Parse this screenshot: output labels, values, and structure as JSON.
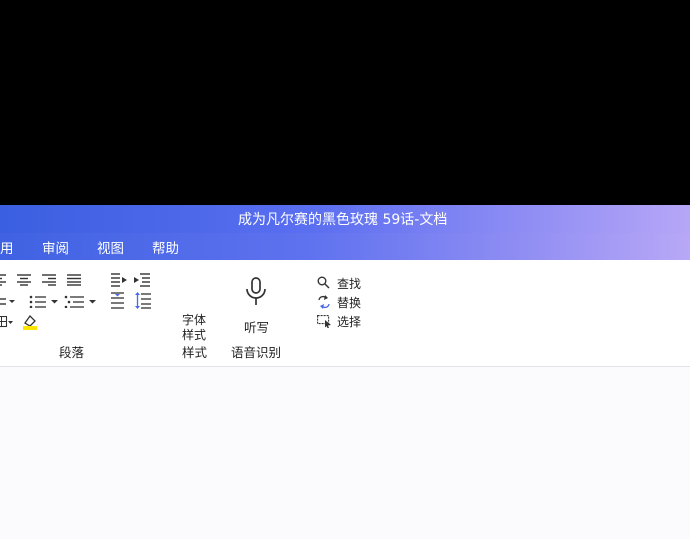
{
  "window": {
    "title": "成为凡尔赛的黑色玫瑰 59话-文档"
  },
  "menu": {
    "items": [
      "用",
      "审阅",
      "视图",
      "帮助"
    ]
  },
  "ribbon": {
    "paragraph": {
      "group_label": "段落"
    },
    "styles": {
      "line1": "字体",
      "line2": "样式",
      "group_label": "样式"
    },
    "voice": {
      "dictate_label": "听写",
      "group_label": "语音识别"
    },
    "editing": {
      "find_label": "查找",
      "replace_label": "替换",
      "select_label": "选择"
    }
  },
  "colors": {
    "accent": "#4a68e8",
    "highlight": "#ffe600"
  },
  "icons": [
    "align-left-icon",
    "align-center-icon",
    "align-right-icon",
    "justify-icon",
    "ltr-icon",
    "increase-indent-icon",
    "bullets-icon",
    "numbering-icon",
    "multilevel-list-icon",
    "line-spacing-icon",
    "paragraph-spacing-icon",
    "borders-icon",
    "shading-icon",
    "microphone-icon",
    "search-icon",
    "replace-icon",
    "select-icon"
  ]
}
